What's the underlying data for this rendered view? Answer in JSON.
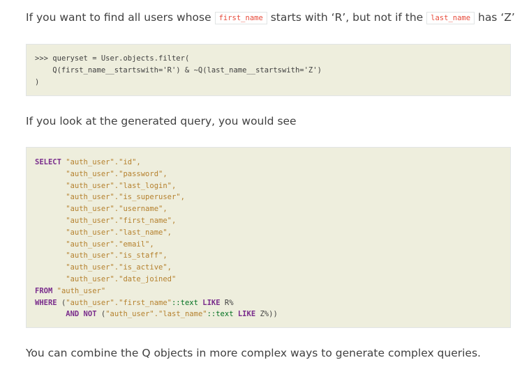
{
  "intro": {
    "before": "If you want to find all users whose ",
    "code1": "first_name",
    "middle": " starts with ‘R’, but not if the ",
    "code2": "last_name",
    "after": " has ‘Z’"
  },
  "python_code": {
    "line1_prompt": ">>> ",
    "line1_rest": "queryset = User.objects.filter(",
    "line2": "    Q(first_name__startswith='R') & ~Q(last_name__startswith='Z')",
    "line3": ")"
  },
  "query_intro": "If you look at the generated query, you would see",
  "sql": {
    "select_kw": "SELECT",
    "cols": [
      "\"auth_user\".\"id\",",
      "\"auth_user\".\"password\",",
      "\"auth_user\".\"last_login\",",
      "\"auth_user\".\"is_superuser\",",
      "\"auth_user\".\"username\",",
      "\"auth_user\".\"first_name\",",
      "\"auth_user\".\"last_name\",",
      "\"auth_user\".\"email\",",
      "\"auth_user\".\"is_staff\",",
      "\"auth_user\".\"is_active\",",
      "\"auth_user\".\"date_joined\""
    ],
    "from_kw": "FROM",
    "from_table": "\"auth_user\"",
    "where_kw": "WHERE",
    "where_open": "(",
    "where_col": "\"auth_user\".\"first_name\"",
    "where_cast": "::text",
    "like_kw": "LIKE",
    "where_val": "R%",
    "and_not_kw": "AND NOT",
    "and_open": "(",
    "and_col": "\"auth_user\".\"last_name\"",
    "and_cast": "::text",
    "and_like_kw": "LIKE",
    "and_val": "Z%))"
  },
  "outro": "You can combine the Q objects in more complex ways to generate complex queries."
}
